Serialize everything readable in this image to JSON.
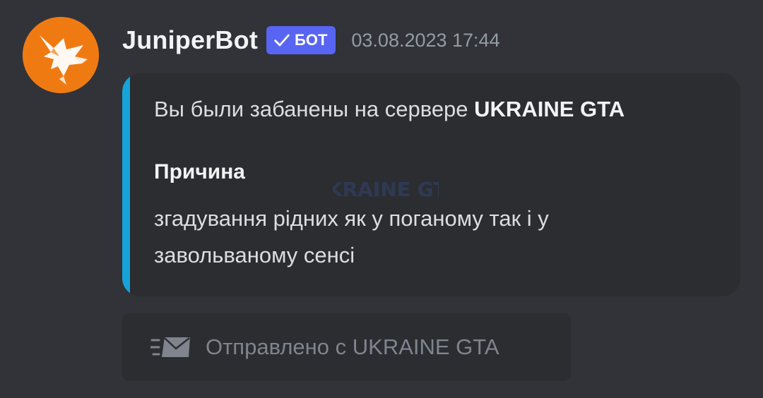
{
  "message": {
    "author": "JuniperBot",
    "badge": "БОТ",
    "timestamp": "03.08.2023 17:44",
    "avatar_icon": "fox-logo-icon"
  },
  "embed": {
    "accent_color": "#16a3d9",
    "title_prefix": "Вы были забанены на сервере ",
    "title_server": "UKRAINE GTA",
    "field_name": "Причина",
    "field_value": "згадування рідних як у поганому так і у завольваному сенсі",
    "watermark_text": "UKRAINE GTA"
  },
  "sent_from": {
    "icon": "mail-send-icon",
    "label": "Отправлено с UKRAINE GTA"
  },
  "colors": {
    "background": "#313338",
    "embed_bg": "#2b2d31",
    "bot_badge": "#5865f2"
  }
}
